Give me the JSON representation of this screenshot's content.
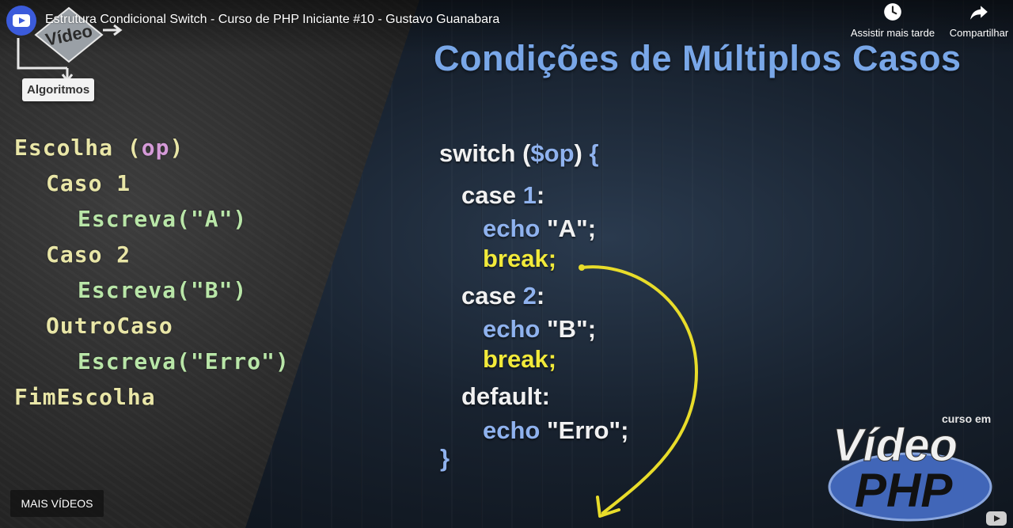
{
  "player": {
    "title": "Estrutura Condicional Switch - Curso de PHP Iniciante #10 - Gustavo Guanabara",
    "watch_later_label": "Assistir mais tarde",
    "share_label": "Compartilhar",
    "more_videos_label": "MAIS VÍDEOS"
  },
  "badge": {
    "top_text": "Vídeo",
    "label": "Algoritmos"
  },
  "chalkboard": {
    "line1_kw": "Escolha",
    "line1_open": "(",
    "line1_var": "op",
    "line1_close": ")",
    "caso1": "Caso 1",
    "escreva_a": "Escreva(\"A\")",
    "caso2": "Caso 2",
    "escreva_b": "Escreva(\"B\")",
    "outro": "OutroCaso",
    "escreva_erro": "Escreva(\"Erro\")",
    "fim": "FimEscolha"
  },
  "slide": {
    "title": "Condições de Múltiplos Casos",
    "switch_kw": "switch",
    "switch_open": " (",
    "switch_var": "$op",
    "switch_close": ") ",
    "brace_open": "{",
    "case_kw": "case ",
    "case1_num": "1",
    "case2_num": "2",
    "colon": ":",
    "echo_kw": "echo ",
    "echo_a": "\"A\";",
    "echo_b": "\"B\";",
    "echo_erro": "\"Erro\";",
    "break_kw": "break;",
    "default_kw": "default:",
    "brace_close": "}"
  },
  "logo": {
    "small": "curso em",
    "big": "Vídeo",
    "sub": "PHP"
  },
  "colors": {
    "title_blue": "#79a7e8",
    "keyword_blue": "#8fb2ee",
    "break_yellow": "#f2ea3a",
    "arrow_yellow": "#e8dc2a"
  }
}
